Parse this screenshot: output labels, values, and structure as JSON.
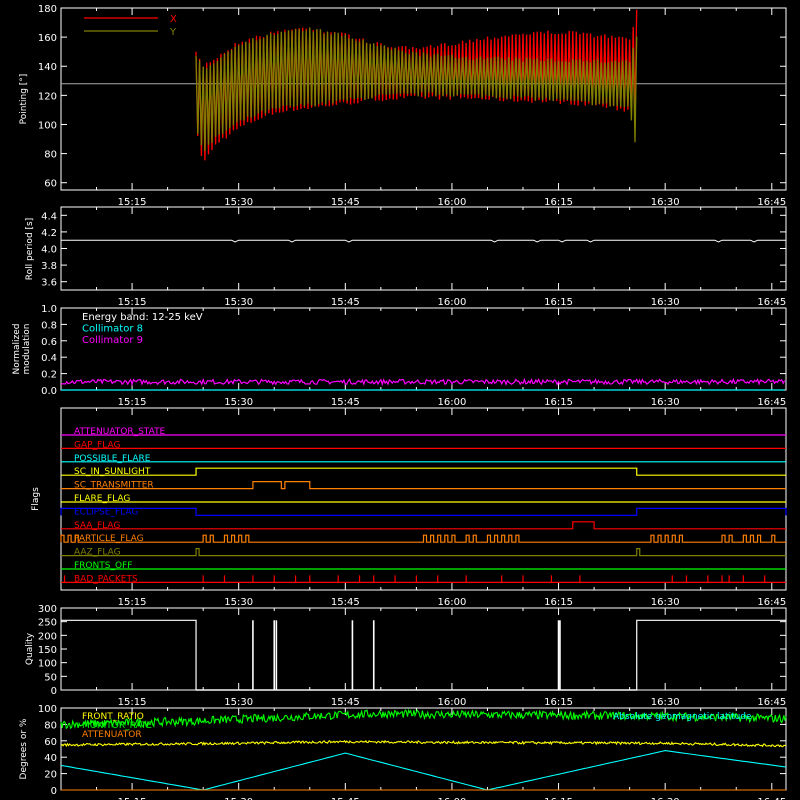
{
  "time_ticks": [
    "15:15",
    "15:30",
    "15:45",
    "16:00",
    "16:15",
    "16:30",
    "16:45"
  ],
  "chart_data": [
    {
      "id": "pointing",
      "type": "line",
      "ylabel": "Pointing [°]",
      "ylim": [
        55,
        180
      ],
      "yticks": [
        60,
        80,
        100,
        120,
        140,
        160,
        180
      ],
      "x_range": [
        "15:05",
        "16:47"
      ],
      "data_start": "15:24",
      "data_end": "16:26",
      "reference_line": 128,
      "legend": [
        {
          "name": "X",
          "color": "#ff0000"
        },
        {
          "name": "Y",
          "color": "#808000"
        }
      ],
      "series": [
        {
          "name": "X",
          "color": "#ff0000",
          "envelope_times": [
            "15:24",
            "15:25",
            "15:27",
            "15:30",
            "15:33",
            "15:36",
            "15:40",
            "15:45",
            "15:50",
            "15:55",
            "16:00",
            "16:05",
            "16:10",
            "16:15",
            "16:20",
            "16:25",
            "16:26"
          ],
          "upper": [
            150,
            142,
            148,
            158,
            162,
            166,
            168,
            163,
            156,
            153,
            157,
            161,
            164,
            165,
            163,
            160,
            180
          ],
          "lower": [
            95,
            72,
            86,
            96,
            103,
            108,
            110,
            113,
            116,
            117,
            117,
            116,
            115,
            114,
            112,
            108,
            110
          ]
        },
        {
          "name": "Y",
          "color": "#808000",
          "envelope_times": [
            "15:24",
            "15:25",
            "15:27",
            "15:30",
            "15:33",
            "15:36",
            "15:40",
            "15:45",
            "15:50",
            "15:55",
            "16:00",
            "16:05",
            "16:10",
            "16:15",
            "16:20",
            "16:25",
            "16:26"
          ],
          "upper": [
            148,
            140,
            146,
            157,
            161,
            165,
            167,
            162,
            155,
            150,
            148,
            147,
            146,
            146,
            145,
            145,
            162
          ],
          "lower": [
            98,
            80,
            90,
            100,
            106,
            110,
            112,
            115,
            118,
            119,
            119,
            118,
            117,
            115,
            113,
            110,
            78
          ]
        }
      ]
    },
    {
      "id": "roll",
      "type": "line",
      "ylabel": "Roll period [s]",
      "ylim": [
        3.5,
        4.5
      ],
      "yticks": [
        "3.6",
        "3.8",
        "4.0",
        "4.2",
        "4.4"
      ],
      "series": [
        {
          "name": "",
          "color": "#ffffff",
          "value": 4.1
        }
      ]
    },
    {
      "id": "modulation",
      "type": "line",
      "ylabel": "Normalized modulation",
      "ylim": [
        0,
        1.0
      ],
      "yticks": [
        "0.0",
        "0.2",
        "0.4",
        "0.6",
        "0.8",
        "1.0"
      ],
      "legend": [
        {
          "name": "Energy band: 12-25 keV",
          "color": "#ffffff"
        },
        {
          "name": "Collimator 8",
          "color": "#00ffff"
        },
        {
          "name": "Collimator 9",
          "color": "#ff00ff"
        }
      ],
      "series": [
        {
          "name": "Collimator 8",
          "color": "#00ffff",
          "value": 0.0
        },
        {
          "name": "Collimator 9",
          "color": "#ff00ff",
          "value": 0.1
        }
      ]
    },
    {
      "id": "flags",
      "type": "line",
      "ylabel": "Flags",
      "series": [
        {
          "name": "ATTENUATOR_STATE",
          "color": "#ff00ff",
          "kind": "const"
        },
        {
          "name": "GAP_FLAG",
          "color": "#ff0000",
          "kind": "const"
        },
        {
          "name": "POSSIBLE_FLARE",
          "color": "#00ffff",
          "kind": "const"
        },
        {
          "name": "SC_IN_SUNLIGHT",
          "color": "#ffff00",
          "kind": "step",
          "high": [
            [
              "15:24",
              "16:26"
            ]
          ]
        },
        {
          "name": "SC_TRANSMITTER",
          "color": "#ff8000",
          "kind": "step",
          "high": [
            [
              "15:32",
              "15:36"
            ],
            [
              "15:36.5",
              "15:40"
            ]
          ]
        },
        {
          "name": "FLARE_FLAG",
          "color": "#ffff00",
          "kind": "const"
        },
        {
          "name": "ECLIPSE_FLAG",
          "color": "#0000ff",
          "kind": "step",
          "high": [
            [
              "15:05",
              "15:24"
            ],
            [
              "16:26",
              "16:47"
            ]
          ]
        },
        {
          "name": "SAA_FLAG",
          "color": "#ff0000",
          "kind": "step",
          "high": [
            [
              "16:17",
              "16:20"
            ]
          ]
        },
        {
          "name": "PARTICLE_FLAG",
          "color": "#ff8000",
          "kind": "pulses",
          "times": [
            "15:05",
            "15:06",
            "15:07",
            "15:25",
            "15:26",
            "15:28",
            "15:29",
            "15:30",
            "15:31",
            "15:56",
            "15:57",
            "15:58",
            "15:59",
            "16:00",
            "16:02",
            "16:03",
            "16:05",
            "16:06",
            "16:07",
            "16:08",
            "16:09",
            "16:28",
            "16:29",
            "16:30",
            "16:31",
            "16:32",
            "16:38",
            "16:39",
            "16:41",
            "16:42",
            "16:43",
            "16:45"
          ]
        },
        {
          "name": "AAZ_FLAG",
          "color": "#808000",
          "kind": "pulses",
          "times": [
            "15:24",
            "16:26"
          ]
        },
        {
          "name": "FRONTS_OFF",
          "color": "#00ff00",
          "kind": "const"
        },
        {
          "name": "BAD_PACKETS",
          "color": "#ff0000",
          "kind": "ticks",
          "times": [
            "15:05.5",
            "15:25",
            "15:28",
            "15:32",
            "15:35",
            "15:38",
            "15:40",
            "15:44",
            "15:47",
            "15:49",
            "15:52",
            "15:55",
            "15:58",
            "16:02",
            "16:07",
            "16:10",
            "16:14",
            "16:18",
            "16:31",
            "16:33",
            "16:36",
            "16:38",
            "16:39",
            "16:41",
            "16:44"
          ]
        }
      ]
    },
    {
      "id": "quality",
      "type": "line",
      "ylabel": "Quality",
      "ylim": [
        0,
        300
      ],
      "yticks": [
        0,
        50,
        100,
        150,
        200,
        250,
        300
      ],
      "level": 255,
      "blocks": [
        [
          "15:05",
          "15:24"
        ],
        [
          "16:26",
          "16:47"
        ]
      ],
      "spikes": [
        "15:32",
        "15:35",
        "15:35.3",
        "15:46",
        "15:49",
        "16:15",
        "16:15.2"
      ]
    },
    {
      "id": "misc",
      "type": "line",
      "ylabel": "Degrees or %",
      "ylim": [
        0,
        100
      ],
      "yticks": [
        0,
        20,
        40,
        60,
        80,
        100
      ],
      "legend": [
        {
          "name": "FRONT_RATIO",
          "color": "#ffff00"
        },
        {
          "name": "MONITOR_RATE",
          "color": "#00ff00"
        },
        {
          "name": "ATTENUATOR",
          "color": "#ff8000"
        },
        {
          "name": "Absolute geomagnetic latitude",
          "color": "#00ffff"
        }
      ],
      "series": [
        {
          "name": "MONITOR_RATE",
          "color": "#00ff00",
          "times": [
            "15:05",
            "15:24",
            "15:40",
            "15:50",
            "16:00",
            "16:30",
            "16:47"
          ],
          "values": [
            80,
            84,
            90,
            93,
            92,
            90,
            87
          ]
        },
        {
          "name": "FRONT_RATIO",
          "color": "#ffff00",
          "times": [
            "15:05",
            "15:30",
            "15:45",
            "16:00",
            "16:30",
            "16:47"
          ],
          "values": [
            55,
            57,
            59,
            58,
            57,
            54
          ]
        },
        {
          "name": "Absolute geomagnetic latitude",
          "color": "#00ffff",
          "times": [
            "15:05",
            "15:25",
            "15:45",
            "16:05",
            "16:30",
            "16:47"
          ],
          "values": [
            30,
            0,
            45,
            0,
            48,
            28
          ]
        },
        {
          "name": "ATTENUATOR",
          "color": "#ff8000",
          "value": 0
        }
      ]
    }
  ]
}
